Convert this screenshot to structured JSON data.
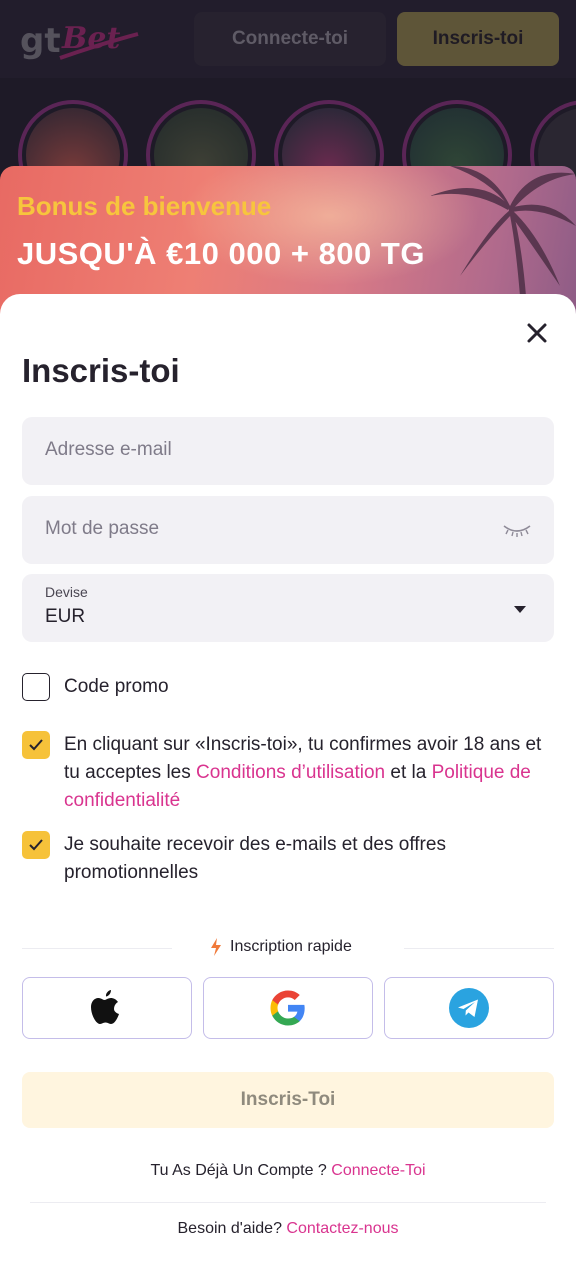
{
  "header": {
    "logo_text": "gtBet",
    "login_label": "Connecte-toi",
    "signup_label": "Inscris-toi"
  },
  "banner": {
    "subtitle": "Bonus de bienvenue",
    "title": "JUSQU'À €10 000 + 800 TG"
  },
  "form": {
    "title": "Inscris-toi",
    "email_placeholder": "Adresse e-mail",
    "password_placeholder": "Mot de passe",
    "currency_label": "Devise",
    "currency_value": "EUR",
    "promo_label": "Code promo",
    "terms": {
      "prefix": "En cliquant sur «Inscris-toi», tu confirmes avoir 18 ans et tu acceptes les ",
      "conditions_link": "Conditions d’utilisation",
      "middle": " et la ",
      "privacy_link": "Politique de confidentialité"
    },
    "marketing_label": "Je souhaite recevoir des e-mails et des offres promotionnelles",
    "quick_signup_label": "Inscription rapide",
    "submit_label": "Inscris-Toi"
  },
  "footer": {
    "have_account_text": "Tu As Déjà Un Compte ?",
    "login_link": "Connecte-Toi",
    "help_text": "Besoin d'aide?",
    "contact_link": "Contactez-nous"
  },
  "colors": {
    "accent_yellow": "#f6c23a",
    "link_pink": "#d9348f",
    "text_dark": "#26222d"
  },
  "icons": {
    "close": "close-icon",
    "eye": "eye-closed-icon",
    "apple": "apple-icon",
    "google": "google-icon",
    "telegram": "telegram-icon",
    "bolt": "lightning-icon"
  }
}
